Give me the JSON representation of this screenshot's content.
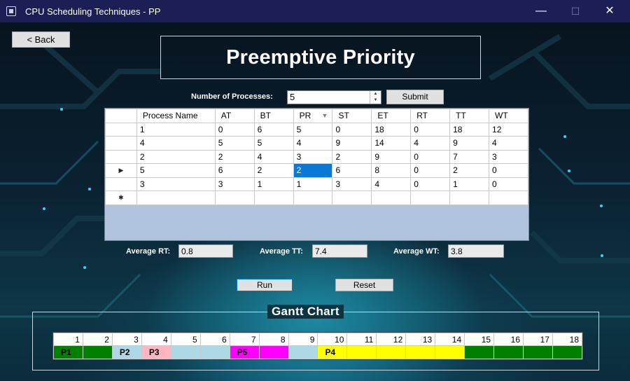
{
  "window": {
    "title": "CPU Scheduling Techniques - PP",
    "icon": "cpu-chip-icon",
    "minimize": "—",
    "maximize": "☐",
    "close": "✕"
  },
  "back_button": {
    "label": "<  Back"
  },
  "header": {
    "title": "Preemptive Priority"
  },
  "process_input": {
    "label": "Number of Processes:",
    "value": "5",
    "submit_label": "Submit"
  },
  "grid": {
    "columns": [
      "Process Name",
      "AT",
      "BT",
      "PR",
      "ST",
      "ET",
      "RT",
      "TT",
      "WT"
    ],
    "sorted_column": "PR",
    "current_row_marker": "▶",
    "new_row_marker": "✱",
    "rows": [
      [
        "1",
        "0",
        "6",
        "5",
        "0",
        "18",
        "0",
        "18",
        "12"
      ],
      [
        "4",
        "5",
        "5",
        "4",
        "9",
        "14",
        "4",
        "9",
        "4"
      ],
      [
        "2",
        "2",
        "4",
        "3",
        "2",
        "9",
        "0",
        "7",
        "3"
      ],
      [
        "5",
        "6",
        "2",
        "2",
        "6",
        "8",
        "0",
        "2",
        "0"
      ],
      [
        "3",
        "3",
        "1",
        "1",
        "3",
        "4",
        "0",
        "1",
        "0"
      ],
      [
        "",
        "",
        "",
        "",
        "",
        "",
        "",
        "",
        ""
      ]
    ],
    "selected_cell": {
      "row": 3,
      "column": "PR"
    }
  },
  "averages": {
    "rt_label": "Average RT:",
    "rt_value": "0.8",
    "tt_label": "Average TT:",
    "tt_value": "7.4",
    "wt_label": "Average WT:",
    "wt_value": "3.8"
  },
  "actions": {
    "run_label": "Run",
    "reset_label": "Reset"
  },
  "gantt": {
    "title": "Gantt Chart",
    "time_labels": [
      "1",
      "2",
      "3",
      "4",
      "5",
      "6",
      "7",
      "8",
      "9",
      "10",
      "11",
      "12",
      "13",
      "14",
      "15",
      "16",
      "17",
      "18"
    ],
    "cells": [
      {
        "label": "P1",
        "color": "#008000"
      },
      {
        "label": "",
        "color": "#008000"
      },
      {
        "label": "P2",
        "color": "#add8e6"
      },
      {
        "label": "P3",
        "color": "#ffb6c1"
      },
      {
        "label": "",
        "color": "#add8e6"
      },
      {
        "label": "",
        "color": "#add8e6"
      },
      {
        "label": "P5",
        "color": "#ff00ff"
      },
      {
        "label": "",
        "color": "#ff00ff"
      },
      {
        "label": "",
        "color": "#add8e6"
      },
      {
        "label": "P4",
        "color": "#ffff00"
      },
      {
        "label": "",
        "color": "#ffff00"
      },
      {
        "label": "",
        "color": "#ffff00"
      },
      {
        "label": "",
        "color": "#ffff00"
      },
      {
        "label": "",
        "color": "#ffff00"
      },
      {
        "label": "",
        "color": "#008000"
      },
      {
        "label": "",
        "color": "#008000"
      },
      {
        "label": "",
        "color": "#008000"
      },
      {
        "label": "",
        "color": "#008000"
      }
    ]
  }
}
